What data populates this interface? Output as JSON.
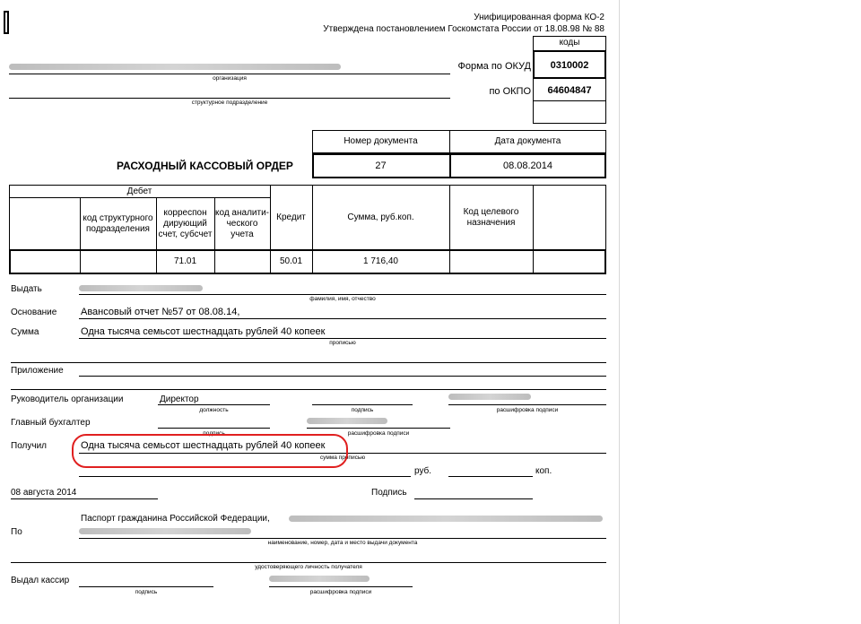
{
  "form": {
    "unified": "Унифицированная форма КО-2",
    "approved": "Утверждена постановлением Госкомстата России от 18.08.98 № 88",
    "codes_header": "коды",
    "okud_label": "Форма по ОКУД",
    "okud_code": "0310002",
    "okpo_label": "по ОКПО",
    "okpo_code": "64604847",
    "org_caption": "организация",
    "subdivision_caption": "структурное подразделение"
  },
  "doc": {
    "title": "РАСХОДНЫЙ КАССОВЫЙ ОРДЕР",
    "num_header": "Номер документа",
    "date_header": "Дата документа",
    "number": "27",
    "date": "08.08.2014"
  },
  "table": {
    "debit": "Дебет",
    "col_subdivision": "код структурного подразделения",
    "col_corr": "корреспон дирующий счет, субсчет",
    "col_analytic": "код аналити-ческого учета",
    "col_credit": "Кредит",
    "col_sum": "Сумма, руб.коп.",
    "col_purpose": "Код целевого назначения",
    "corr_value": "71.01",
    "credit_value": "50.01",
    "sum_value": "1 716,40"
  },
  "fields": {
    "issue_label": "Выдать",
    "issue_caption": "фамилия, имя, отчество",
    "basis_label": "Основание",
    "basis_value": "Авансовый отчет №57 от 08.08.14,",
    "sum_label": "Сумма",
    "sum_value": "Одна тысяча семьсот шестнадцать рублей 40 копеек",
    "sum_caption": "прописью",
    "attachment_label": "Приложение",
    "head_label": "Руководитель организации",
    "head_position": "Директор",
    "position_caption": "должность",
    "signature_caption": "подпись",
    "decode_caption": "расшифровка подписи",
    "chief_acc_label": "Главный бухгалтер",
    "received_label": "Получил",
    "received_value": "Одна тысяча семьсот шестнадцать рублей 40 копеек",
    "received_caption": "сумма прописью",
    "rub": "руб.",
    "kop": "коп.",
    "date_value": "08 августа 2014",
    "signature_label": "Подпись",
    "by_label": "По",
    "passport_value": "Паспорт гражданина Российской Федерации,",
    "doc_caption": "наименование, номер, дата и место выдачи документа",
    "identity_caption": "удостоверяющего личность получателя",
    "cashier_label": "Выдал кассир"
  },
  "colors": {
    "highlight": "#e02020"
  }
}
